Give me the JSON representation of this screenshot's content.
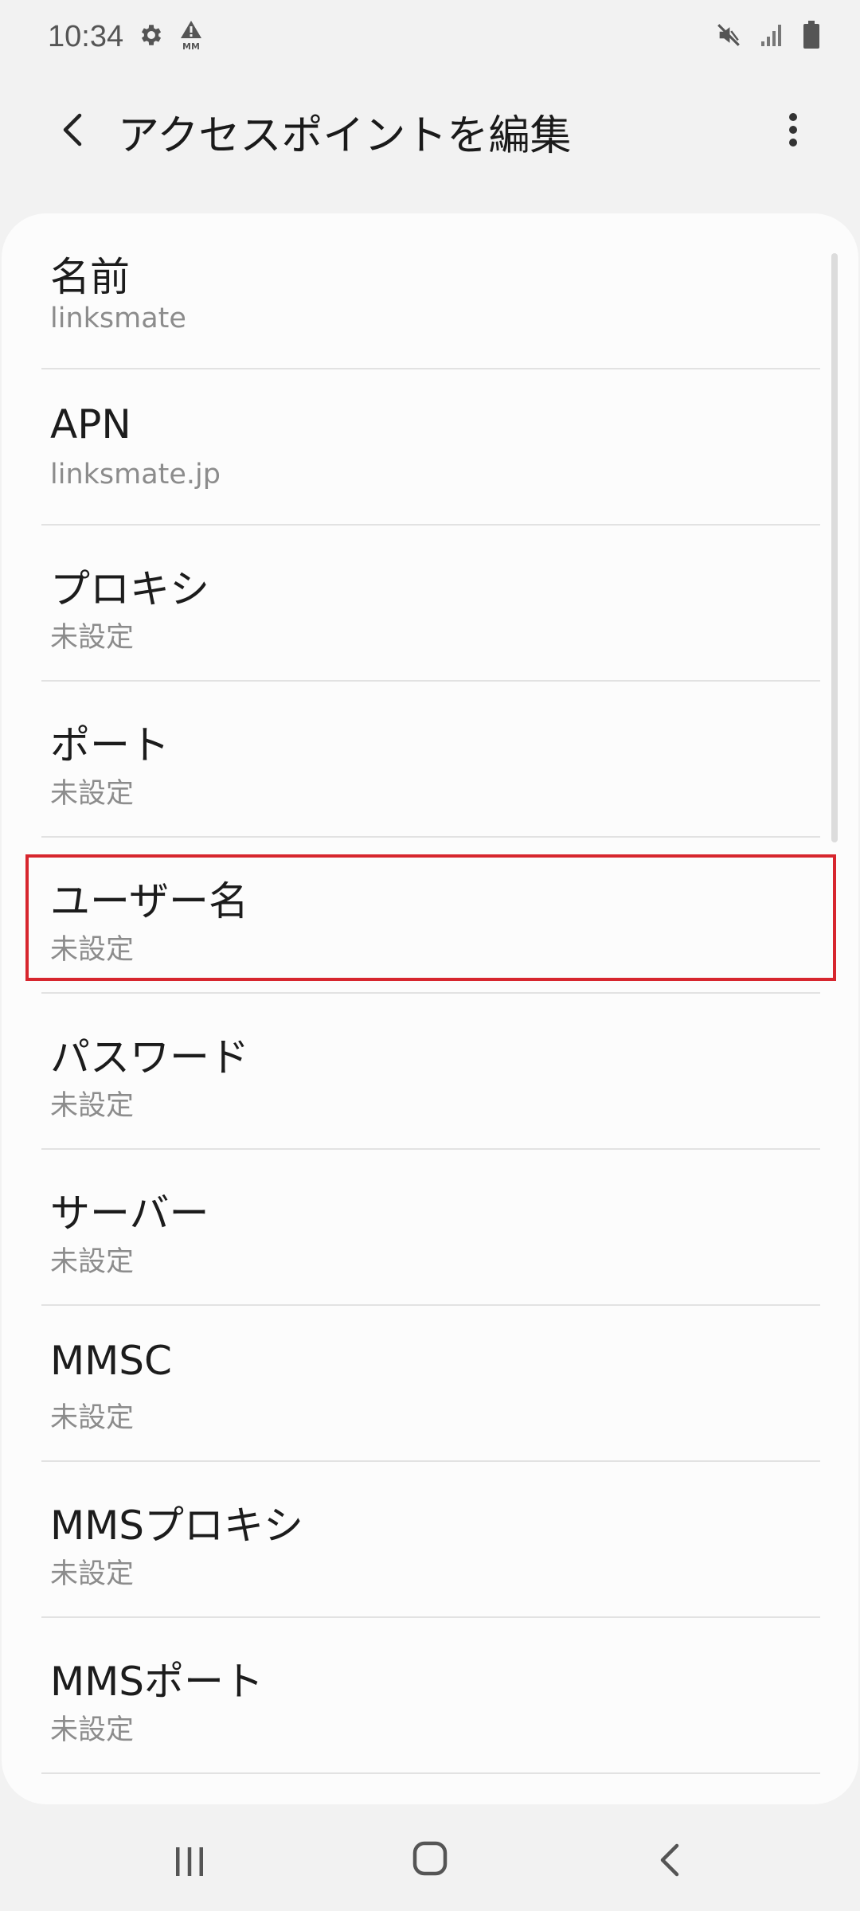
{
  "status_bar": {
    "time": "10:34",
    "left_icons": [
      "gear-icon",
      "mm-alert-icon"
    ],
    "right_icons": [
      "mute-icon",
      "signal-icon",
      "battery-icon"
    ]
  },
  "app_bar": {
    "title": "アクセスポイントを編集",
    "back_icon": "chevron-left-icon",
    "more_icon": "more-vert-icon"
  },
  "items": [
    {
      "title": "名前",
      "value": "linksmate"
    },
    {
      "title": "APN",
      "value": "linksmate.jp"
    },
    {
      "title": "プロキシ",
      "value": "未設定"
    },
    {
      "title": "ポート",
      "value": "未設定"
    },
    {
      "title": "ユーザー名",
      "value": "未設定"
    },
    {
      "title": "パスワード",
      "value": "未設定"
    },
    {
      "title": "サーバー",
      "value": "未設定"
    },
    {
      "title": "MMSC",
      "value": "未設定"
    },
    {
      "title": "MMSプロキシ",
      "value": "未設定"
    },
    {
      "title": "MMSポート",
      "value": "未設定"
    }
  ],
  "highlight": {
    "item_index": 4,
    "color": "#d7262e"
  },
  "nav_bar": {
    "icons": [
      "recents-icon",
      "home-icon",
      "back-icon"
    ]
  }
}
